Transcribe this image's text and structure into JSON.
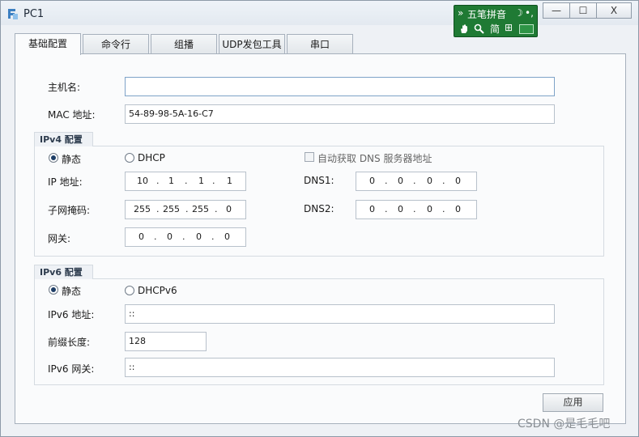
{
  "window": {
    "title": "PC1",
    "controls": {
      "minimize": "—",
      "maximize": "☐",
      "close": "X"
    }
  },
  "ime": {
    "name": "五笔拼音",
    "mode": "简",
    "toggle": "»",
    "moon": "☽",
    "punct": "•,",
    "extra": "⊞"
  },
  "tabs": [
    "基础配置",
    "命令行",
    "组播",
    "UDP发包工具",
    "串口"
  ],
  "basic": {
    "hostname_label": "主机名:",
    "hostname_value": "",
    "mac_label": "MAC 地址:",
    "mac_value": "54-89-98-5A-16-C7"
  },
  "ipv4": {
    "title": "IPv4 配置",
    "static_label": "静态",
    "dhcp_label": "DHCP",
    "auto_dns_label": "自动获取 DNS 服务器地址",
    "ip_label": "IP 地址:",
    "mask_label": "子网掩码:",
    "gateway_label": "网关:",
    "dns1_label": "DNS1:",
    "dns2_label": "DNS2:",
    "ip": [
      "10",
      "1",
      "1",
      "1"
    ],
    "mask": [
      "255",
      "255",
      "255",
      "0"
    ],
    "gateway": [
      "0",
      "0",
      "0",
      "0"
    ],
    "dns1": [
      "0",
      "0",
      "0",
      "0"
    ],
    "dns2": [
      "0",
      "0",
      "0",
      "0"
    ],
    "dot": "."
  },
  "ipv6": {
    "title": "IPv6 配置",
    "static_label": "静态",
    "dhcp_label": "DHCPv6",
    "addr_label": "IPv6 地址:",
    "addr_value": "::",
    "prefix_label": "前缀长度:",
    "prefix_value": "128",
    "gw_label": "IPv6 网关:",
    "gw_value": "::"
  },
  "apply_label": "应用",
  "watermark": "CSDN @是毛毛吧"
}
